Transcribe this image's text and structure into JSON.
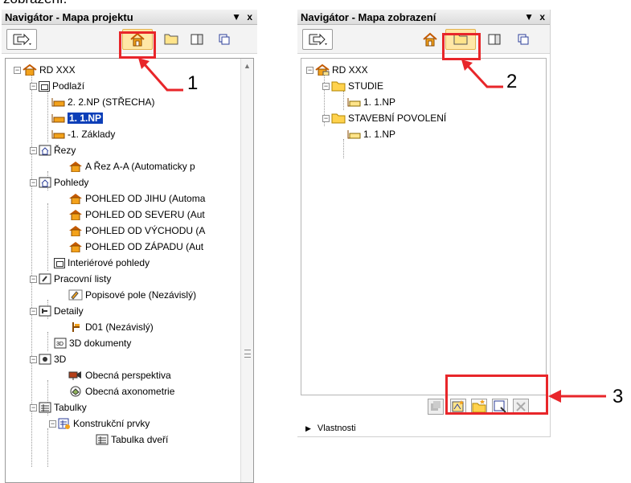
{
  "caption_fragment": "zobrazení.",
  "left_panel": {
    "title": "Navigátor - Mapa projektu",
    "title_controls": "▼ x",
    "tree": [
      {
        "label": "RD XXX",
        "icon": "house-project-icon"
      },
      {
        "label": "Podlaží",
        "icon": "stories-icon"
      },
      {
        "label": "2. 2.NP (STŘECHA)",
        "icon": "story-icon"
      },
      {
        "label": "1. 1.NP",
        "icon": "story-icon"
      },
      {
        "label": "-1. Základy",
        "icon": "story-icon"
      },
      {
        "label": "Řezy",
        "icon": "sections-icon"
      },
      {
        "label": "A Řez A-A (Automaticky p",
        "icon": "section-icon"
      },
      {
        "label": "Pohledy",
        "icon": "elevations-icon"
      },
      {
        "label": "POHLED OD JIHU (Automa",
        "icon": "elevation-icon"
      },
      {
        "label": "POHLED OD SEVERU (Aut",
        "icon": "elevation-icon"
      },
      {
        "label": "POHLED OD VÝCHODU (A",
        "icon": "elevation-icon"
      },
      {
        "label": "POHLED OD ZÁPADU (Aut",
        "icon": "elevation-icon"
      },
      {
        "label": "Interiérové pohledy",
        "icon": "interior-elevations-icon"
      },
      {
        "label": "Pracovní listy",
        "icon": "worksheets-icon"
      },
      {
        "label": "Popisové pole (Nezávislý)",
        "icon": "worksheet-icon"
      },
      {
        "label": "Detaily",
        "icon": "details-icon"
      },
      {
        "label": "D01 (Nezávislý)",
        "icon": "detail-icon"
      },
      {
        "label": "3D dokumenty",
        "icon": "3d-documents-icon"
      },
      {
        "label": "3D",
        "icon": "3d-icon"
      },
      {
        "label": "Obecná perspektiva",
        "icon": "perspective-camera-icon"
      },
      {
        "label": "Obecná axonometrie",
        "icon": "axonometry-icon"
      },
      {
        "label": "Tabulky",
        "icon": "schedules-icon"
      },
      {
        "label": "Konstrukční prvky",
        "icon": "schedule-group-icon"
      },
      {
        "label": "Tabulka dveří",
        "icon": "schedule-icon"
      }
    ],
    "callout_number": "1"
  },
  "right_panel": {
    "title": "Navigátor - Mapa zobrazení",
    "title_controls": "▼ x",
    "tree": [
      {
        "label": "RD XXX",
        "icon": "view-map-root-icon"
      },
      {
        "label": "STUDIE",
        "icon": "folder-icon"
      },
      {
        "label": "1. 1.NP",
        "icon": "story-view-icon"
      },
      {
        "label": "STAVEBNÍ POVOLENÍ",
        "icon": "folder-icon"
      },
      {
        "label": "1. 1.NP",
        "icon": "story-view-icon"
      }
    ],
    "callout_number": "2",
    "bottom_callout_number": "3",
    "properties_label": "Vlastnosti"
  },
  "colors": {
    "highlight_red": "#e8262a",
    "selection_blue": "#0d3fb8",
    "pressed_button": "#ffe7a6"
  }
}
